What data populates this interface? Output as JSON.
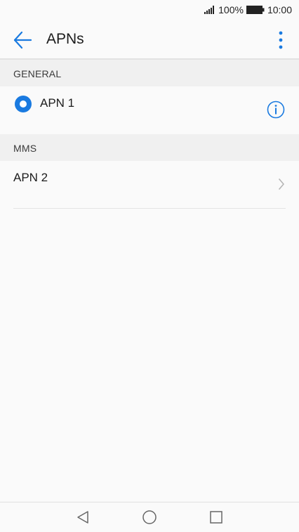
{
  "status_bar": {
    "battery_percent": "100%",
    "time": "10:00",
    "icons": [
      "signal-icon",
      "battery-icon"
    ]
  },
  "app_bar": {
    "title": "APNs",
    "back_icon": "arrow-left-icon",
    "menu_icon": "more-vertical-icon"
  },
  "sections": [
    {
      "header": "GENERAL",
      "items": [
        {
          "label": "APN 1",
          "selected": true,
          "trailing_icon": "info-icon"
        }
      ]
    },
    {
      "header": "MMS",
      "items": [
        {
          "label": "APN 2",
          "trailing_icon": "chevron-right-icon"
        }
      ]
    }
  ],
  "nav_bar": {
    "icons": [
      "back-triangle-icon",
      "home-circle-icon",
      "recents-square-icon"
    ]
  },
  "colors": {
    "accent": "#1a7ae0",
    "text": "#1c1c1c",
    "section_bg": "#f0f0f0",
    "background": "#fafafa"
  }
}
